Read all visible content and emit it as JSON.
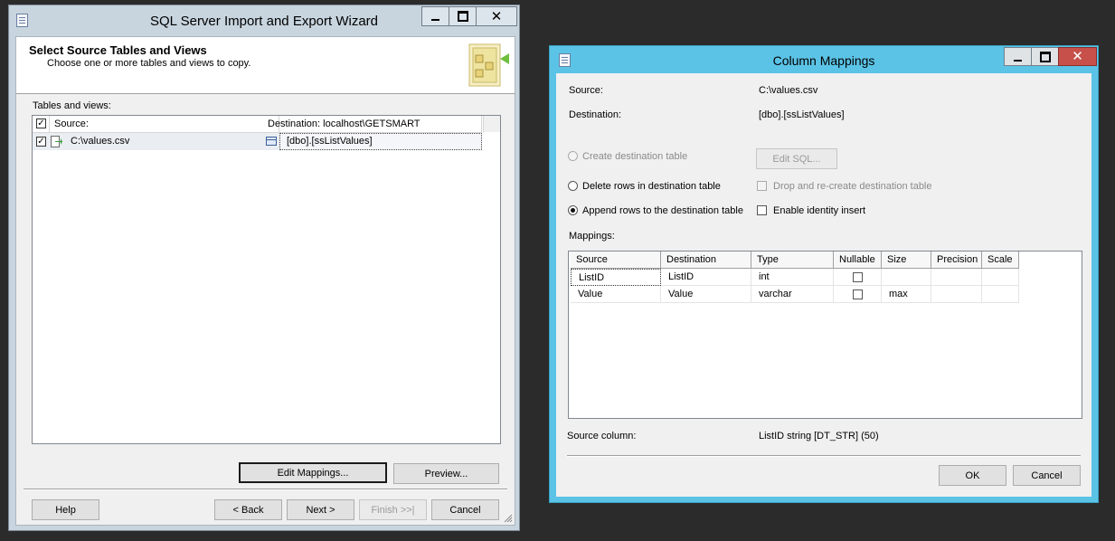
{
  "wizard": {
    "title": "SQL Server Import and Export Wizard",
    "header_title": "Select Source Tables and Views",
    "header_subtitle": "Choose one or more tables and views to copy.",
    "tables_label": "Tables and views:",
    "columns": {
      "source": "Source:",
      "destination": "Destination: localhost\\GETSMART"
    },
    "rows": [
      {
        "checked": true,
        "source": "C:\\values.csv",
        "destination": "[dbo].[ssListValues]"
      }
    ],
    "buttons": {
      "edit_mappings": "Edit Mappings...",
      "preview": "Preview...",
      "help": "Help",
      "back": "< Back",
      "next": "Next >",
      "finish": "Finish >>|",
      "cancel": "Cancel"
    }
  },
  "mappings_dialog": {
    "title": "Column Mappings",
    "source_label": "Source:",
    "source_value": "C:\\values.csv",
    "destination_label": "Destination:",
    "destination_value": "[dbo].[ssListValues]",
    "options": {
      "create_table": "Create destination table",
      "edit_sql": "Edit SQL...",
      "delete_rows": "Delete rows in destination table",
      "drop_recreate": "Drop and re-create destination table",
      "append_rows": "Append rows to the destination table",
      "identity_insert": "Enable identity insert"
    },
    "selected_option": "append_rows",
    "mappings_label": "Mappings:",
    "grid_headers": [
      "Source",
      "Destination",
      "Type",
      "Nullable",
      "Size",
      "Precision",
      "Scale"
    ],
    "grid_rows": [
      {
        "source": "ListID",
        "destination": "ListID",
        "type": "int",
        "nullable": false,
        "size": "",
        "precision": "",
        "scale": ""
      },
      {
        "source": "Value",
        "destination": "Value",
        "type": "varchar",
        "nullable": false,
        "size": "max",
        "precision": "",
        "scale": ""
      }
    ],
    "source_column_label": "Source column:",
    "source_column_value": "ListID string [DT_STR] (50)",
    "buttons": {
      "ok": "OK",
      "cancel": "Cancel"
    }
  }
}
